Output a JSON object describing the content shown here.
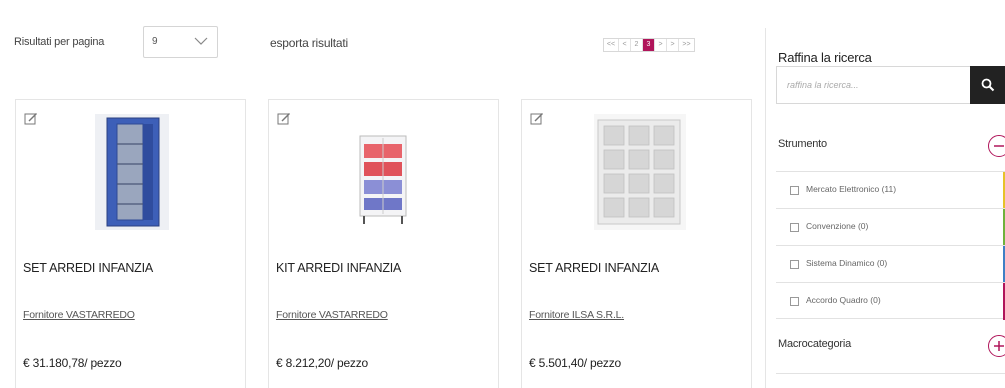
{
  "toolbar": {
    "results_per_page_label": "Risultati per pagina",
    "results_per_page_value": "9",
    "export_label": "esporta risultati"
  },
  "pagination": {
    "first": "<<",
    "prev": "<",
    "pages": [
      "2",
      "3"
    ],
    "current_page": "3",
    "next": ">",
    "next2": ">",
    "last": ">>"
  },
  "products": [
    {
      "title": "SET ARREDI INFANZIA",
      "supplier": "Fornitore VASTARREDO",
      "price": "€ 31.180,78/ pezzo"
    },
    {
      "title": "KIT ARREDI INFANZIA",
      "supplier": "Fornitore VASTARREDO",
      "price": "€ 8.212,20/ pezzo"
    },
    {
      "title": "SET ARREDI INFANZIA",
      "supplier": "Fornitore ILSA S.R.L.",
      "price": "€ 5.501,40/ pezzo"
    }
  ],
  "sidebar": {
    "title": "Raffina la ricerca",
    "search_placeholder": "raffina la ricerca...",
    "facets": [
      {
        "title": "Strumento",
        "expanded": true,
        "options": [
          {
            "label": "Mercato Elettronico (11)",
            "color": "#e6c229"
          },
          {
            "label": "Convenzione (0)",
            "color": "#6fb23b"
          },
          {
            "label": "Sistema Dinamico (0)",
            "color": "#3f7fc5"
          },
          {
            "label": "Accordo Quadro (0)",
            "color": "#b0155a"
          }
        ]
      },
      {
        "title": "Macrocategoria",
        "expanded": false
      }
    ]
  },
  "colors": {
    "accent": "#b0155a",
    "search_button": "#222222"
  }
}
